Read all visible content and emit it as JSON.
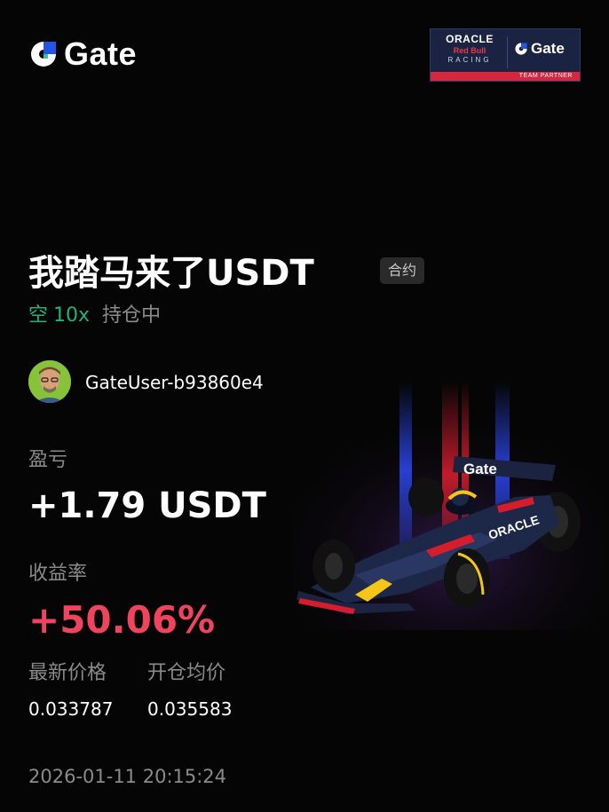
{
  "brand": {
    "name": "Gate"
  },
  "partner_badge": {
    "line1": "ORACLE",
    "line2": "Red Bull",
    "line3": "RACING",
    "brand": "Gate",
    "strip": "TEAM PARTNER"
  },
  "position": {
    "symbol": "我踏马来了USDT",
    "tag": "合约",
    "side": "空",
    "leverage": "10x",
    "status": "持仓中"
  },
  "user": {
    "name": "GateUser-b93860e4"
  },
  "pnl": {
    "label": "盈亏",
    "value": "+1.79 USDT"
  },
  "roi": {
    "label": "收益率",
    "value": "+50.06%"
  },
  "prices": {
    "last_label": "最新价格",
    "last_value": "0.033787",
    "entry_label": "开仓均价",
    "entry_value": "0.035583"
  },
  "timestamp": "2026-01-11 20:15:24",
  "colors": {
    "brand_blue": "#2354e6",
    "long_green": "#22b07d",
    "profit_red": "#f0445e"
  },
  "car": {
    "livery_text": "Gate"
  }
}
